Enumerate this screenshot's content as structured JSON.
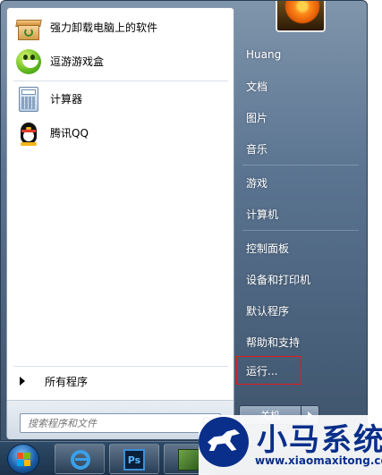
{
  "start_menu": {
    "programs": [
      {
        "label": "强力卸载电脑上的软件",
        "icon": "uninstall-box-icon"
      },
      {
        "label": "逗游游戏盒",
        "icon": "game-box-icon"
      },
      {
        "label": "计算器",
        "icon": "calculator-icon"
      },
      {
        "label": "腾讯QQ",
        "icon": "qq-penguin-icon"
      }
    ],
    "all_programs_label": "所有程序",
    "search_placeholder": "搜索程序和文件",
    "right_links": [
      {
        "label": "Huang"
      },
      {
        "label": "文档"
      },
      {
        "label": "图片"
      },
      {
        "label": "音乐"
      },
      {
        "label": "游戏"
      },
      {
        "label": "计算机"
      },
      {
        "label": "控制面板"
      },
      {
        "label": "设备和打印机"
      },
      {
        "label": "默认程序"
      },
      {
        "label": "帮助和支持"
      },
      {
        "label": "运行..."
      }
    ],
    "shutdown_label": "关机",
    "highlight_color": "#e11a1a"
  },
  "taskbar": {
    "items": [
      "start-orb",
      "internet-explorer-icon",
      "photoshop-icon",
      "app-icon"
    ],
    "photoshop_text": "Ps"
  },
  "watermark": {
    "title": "小马系统",
    "url": "www.xiaomaxitong.com"
  }
}
